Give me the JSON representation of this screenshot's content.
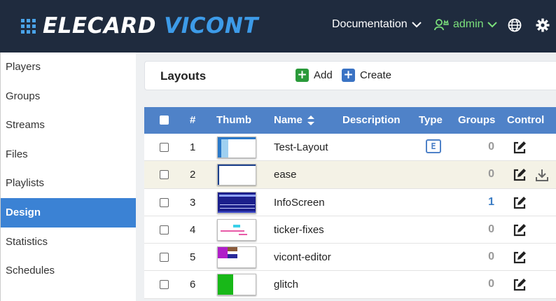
{
  "app": {
    "logo_word1": "ELECARD",
    "logo_word2": "VICONT"
  },
  "topnav": {
    "documentation": "Documentation",
    "user": "admin"
  },
  "sidebar": {
    "items": [
      {
        "label": "Players"
      },
      {
        "label": "Groups"
      },
      {
        "label": "Streams"
      },
      {
        "label": "Files"
      },
      {
        "label": "Playlists"
      },
      {
        "label": "Design"
      },
      {
        "label": "Statistics"
      },
      {
        "label": "Schedules"
      }
    ],
    "active": "Design"
  },
  "page": {
    "title": "Layouts",
    "add_label": "Add",
    "create_label": "Create"
  },
  "table": {
    "headers": {
      "num": "#",
      "thumb": "Thumb",
      "name": "Name",
      "description": "Description",
      "type": "Type",
      "groups": "Groups",
      "control": "Control"
    },
    "rows": [
      {
        "num": "1",
        "name": "Test-Layout",
        "description": "",
        "type": "E",
        "groups": "0"
      },
      {
        "num": "2",
        "name": "ease",
        "description": "",
        "type": "",
        "groups": "0"
      },
      {
        "num": "3",
        "name": "InfoScreen",
        "description": "",
        "type": "",
        "groups": "1"
      },
      {
        "num": "4",
        "name": "ticker-fixes",
        "description": "",
        "type": "",
        "groups": "0"
      },
      {
        "num": "5",
        "name": "vicont-editor",
        "description": "",
        "type": "",
        "groups": "0"
      },
      {
        "num": "6",
        "name": "glitch",
        "description": "",
        "type": "",
        "groups": "0"
      }
    ]
  },
  "colors": {
    "topbar": "#1f2b3e",
    "accent": "#3b82d4",
    "table_header": "#4f82c8",
    "highlight_row": "#f4f2e6",
    "user_green": "#7be07b"
  }
}
